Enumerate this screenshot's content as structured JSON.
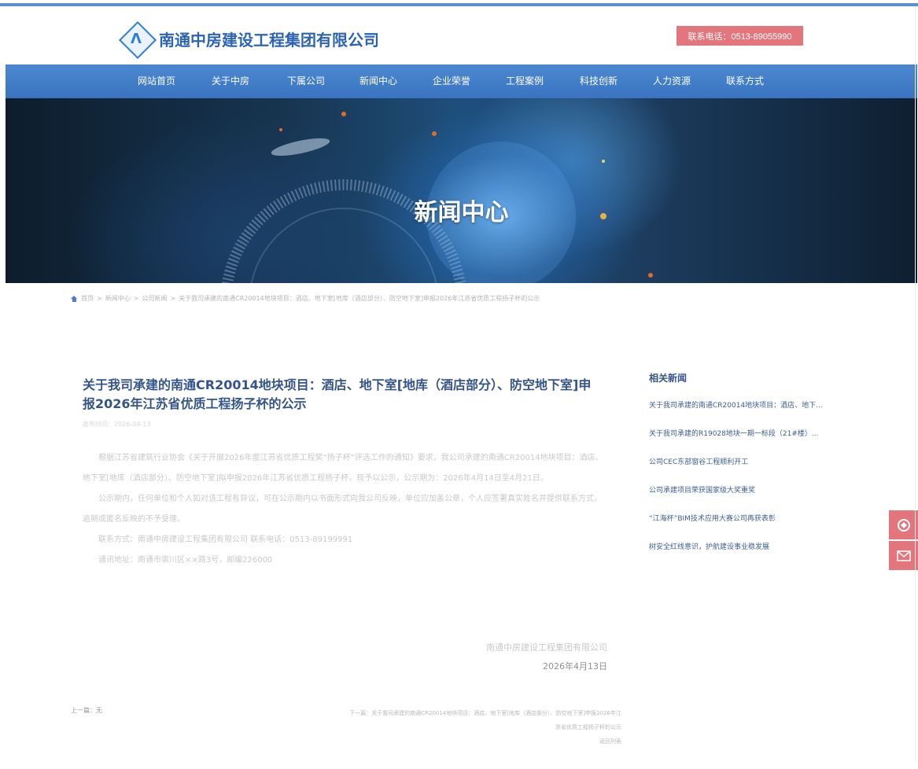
{
  "header": {
    "company_name": "南通中房建设工程集团有限公司",
    "hotline": "联系电话：0513-89055990"
  },
  "nav": {
    "items": [
      {
        "label": "网站首页"
      },
      {
        "label": "关于中房"
      },
      {
        "label": "下属公司"
      },
      {
        "label": "新闻中心"
      },
      {
        "label": "企业荣誉"
      },
      {
        "label": "工程案例"
      },
      {
        "label": "科技创新"
      },
      {
        "label": "人力资源"
      },
      {
        "label": "联系方式"
      }
    ]
  },
  "banner": {
    "title": "新闻中心"
  },
  "breadcrumb": {
    "home": "首页",
    "items": [
      "新闻中心",
      "公司新闻",
      "关于我司承建的南通CR20014地块项目：酒店、地下室[地库（酒店部分）、防空地下室]申报2026年江苏省优质工程扬子杯的公示"
    ]
  },
  "article": {
    "title": "关于我司承建的南通CR20014地块项目：酒店、地下室[地库（酒店部分）、防空地下室]申报2026年江苏省优质工程扬子杯的公示",
    "meta": "发布时间：2026-04-13",
    "paragraphs": [
      "根据江苏省建筑行业协会《关于开展2026年度江苏省优质工程奖“扬子杯”评选工作的通知》要求，我公司承建的南通CR20014地块项目：酒店、地下室[地库（酒店部分）、防空地下室]拟申报2026年江苏省优质工程扬子杯，现予以公示，公示期为：2026年4月14日至4月21日。",
      "公示期内，任何单位和个人如对该工程有异议，可在公示期内以书面形式向我公司反映，单位应加盖公章，个人应签署真实姓名并提供联系方式，逾期或匿名反映的不予受理。",
      "联系方式：南通中房建设工程集团有限公司 联系电话：0513-89199991",
      "通讯地址：南通市崇川区××路3号，邮编226000"
    ],
    "sign_company": "南通中房建设工程集团有限公司",
    "sign_date": "2026年4月13日"
  },
  "related": {
    "title": "相关新闻",
    "items": [
      "关于我司承建的南通CR20014地块项目：酒店、地下...",
      "关于我司承建的R19028地块一期一标段（21#楼）...",
      "公司CEC东部窗谷工程顺利开工",
      "公司承建项目荣获国家级大奖重奖",
      "“江海杯”BIM技术应用大赛公司再获表彰",
      "树安全红线意识，护航建设事业稳发展"
    ]
  },
  "side_tools": {
    "phone_icon": "phone-icon",
    "mail_icon": "mail-icon"
  },
  "footer": {
    "left": "上一篇：无",
    "right_line1": "下一篇：关于我司承建的南通CR20014地块项目：酒店、地下室[地库（酒店部分）、防空地下室]申报2026年江苏省优质工程扬子杯的公示",
    "right_line2": "返回列表"
  },
  "colors": {
    "nav_blue": "#3a74c0",
    "accent_red": "#e3767c",
    "title_blue": "#34558a"
  }
}
